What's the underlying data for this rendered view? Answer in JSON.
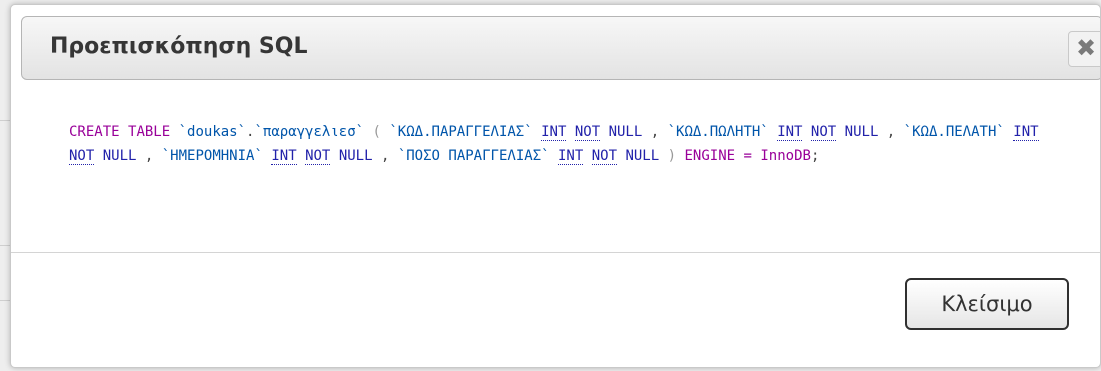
{
  "dialog": {
    "title": "Προεπισκόπηση SQL",
    "close_glyph": "✖",
    "close_icon": "close-icon",
    "button_label": "Κλείσιμο"
  },
  "sql": {
    "tokens": [
      {
        "t": "CREATE",
        "c": "kw"
      },
      {
        "t": " ",
        "c": "punc"
      },
      {
        "t": "TABLE",
        "c": "kw"
      },
      {
        "t": " ",
        "c": "punc"
      },
      {
        "t": "`doukas`",
        "c": "ident"
      },
      {
        "t": ".",
        "c": "punc"
      },
      {
        "t": "`παραγγελιεσ`",
        "c": "ident"
      },
      {
        "t": " ",
        "c": "punc"
      },
      {
        "t": "(",
        "c": "paren"
      },
      {
        "t": " ",
        "c": "punc"
      },
      {
        "t": "`ΚΩΔ.ΠΑΡΑΓΓΕΛΙΑΣ`",
        "c": "ident"
      },
      {
        "t": " ",
        "c": "punc"
      },
      {
        "t": "INT",
        "c": "ty"
      },
      {
        "t": " ",
        "c": "punc"
      },
      {
        "t": "NOT",
        "c": "ty"
      },
      {
        "t": " ",
        "c": "punc"
      },
      {
        "t": "NULL",
        "c": "tyu"
      },
      {
        "t": " , ",
        "c": "punc"
      },
      {
        "t": "`ΚΩΔ.ΠΩΛΗΤΗ`",
        "c": "ident"
      },
      {
        "t": " ",
        "c": "punc"
      },
      {
        "t": "INT",
        "c": "ty"
      },
      {
        "t": " ",
        "c": "punc"
      },
      {
        "t": "NOT",
        "c": "ty"
      },
      {
        "t": " ",
        "c": "punc"
      },
      {
        "t": "NULL",
        "c": "tyu"
      },
      {
        "t": " , ",
        "c": "punc"
      },
      {
        "t": "`ΚΩΔ.ΠΕΛΑΤΗ`",
        "c": "ident"
      },
      {
        "t": " ",
        "c": "punc"
      },
      {
        "t": "INT",
        "c": "ty"
      },
      {
        "t": " ",
        "c": "punc"
      },
      {
        "t": "NOT",
        "c": "ty"
      },
      {
        "t": " ",
        "c": "punc"
      },
      {
        "t": "NULL",
        "c": "tyu"
      },
      {
        "t": " , ",
        "c": "punc"
      },
      {
        "t": "`ΗΜΕΡΟΜΗΝΙΑ`",
        "c": "ident"
      },
      {
        "t": " ",
        "c": "punc"
      },
      {
        "t": "INT",
        "c": "ty"
      },
      {
        "t": " ",
        "c": "punc"
      },
      {
        "t": "NOT",
        "c": "ty"
      },
      {
        "t": " ",
        "c": "punc"
      },
      {
        "t": "NULL",
        "c": "tyu"
      },
      {
        "t": " , ",
        "c": "punc"
      },
      {
        "t": "`ΠΟΣΟ ΠΑΡΑΓΓΕΛΙΑΣ`",
        "c": "ident"
      },
      {
        "t": " ",
        "c": "punc"
      },
      {
        "t": "INT",
        "c": "ty"
      },
      {
        "t": " ",
        "c": "punc"
      },
      {
        "t": "NOT",
        "c": "ty"
      },
      {
        "t": " ",
        "c": "punc"
      },
      {
        "t": "NULL",
        "c": "tyu"
      },
      {
        "t": " ",
        "c": "punc"
      },
      {
        "t": ")",
        "c": "paren"
      },
      {
        "t": " ",
        "c": "punc"
      },
      {
        "t": "ENGINE",
        "c": "kw"
      },
      {
        "t": " ",
        "c": "punc"
      },
      {
        "t": "=",
        "c": "eq"
      },
      {
        "t": " ",
        "c": "punc"
      },
      {
        "t": "InnoDB",
        "c": "kw"
      },
      {
        "t": ";",
        "c": "punc"
      }
    ]
  },
  "colors": {
    "keyword": "#990099",
    "type": "#2222aa",
    "identifier": "#0055aa",
    "paren": "#999999"
  }
}
